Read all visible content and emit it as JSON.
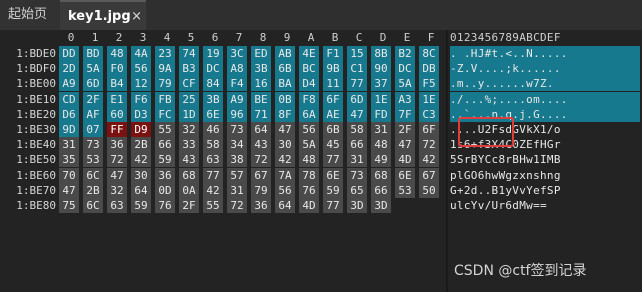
{
  "tabs": [
    {
      "label": "起始页"
    },
    {
      "label": "key1.jpg",
      "close": "×"
    }
  ],
  "columns": [
    "0",
    "1",
    "2",
    "3",
    "4",
    "5",
    "6",
    "7",
    "8",
    "9",
    "A",
    "B",
    "C",
    "D",
    "E",
    "F"
  ],
  "ascii_header": "0123456789ABCDEF",
  "rows": [
    {
      "offset": "1:BDE0",
      "bytes": [
        "DD",
        "BD",
        "48",
        "4A",
        "23",
        "74",
        "19",
        "3C",
        "ED",
        "AB",
        "4E",
        "F1",
        "15",
        "8B",
        "B2",
        "8C"
      ],
      "ascii": ". .HJ#t.<..N....."
    },
    {
      "offset": "1:BDF0",
      "bytes": [
        "2D",
        "5A",
        "F0",
        "56",
        "9A",
        "B3",
        "DC",
        "A8",
        "3B",
        "6B",
        "BC",
        "9B",
        "C1",
        "90",
        "DC",
        "DB"
      ],
      "ascii": "-Z.V....;k......"
    },
    {
      "offset": "1:BE00",
      "bytes": [
        "A9",
        "6D",
        "B4",
        "12",
        "79",
        "CF",
        "84",
        "F4",
        "16",
        "BA",
        "D4",
        "11",
        "77",
        "37",
        "5A",
        "F5"
      ],
      "ascii": ".m..y......w7Z."
    },
    {
      "offset": "1:BE10",
      "bytes": [
        "CD",
        "2F",
        "E1",
        "F6",
        "FB",
        "25",
        "3B",
        "A9",
        "BE",
        "0B",
        "F8",
        "6F",
        "6D",
        "1E",
        "A3",
        "1E"
      ],
      "ascii": "./...%;....om...."
    },
    {
      "offset": "1:BE20",
      "bytes": [
        "D6",
        "AF",
        "60",
        "D3",
        "FC",
        "1D",
        "6E",
        "96",
        "71",
        "8F",
        "6A",
        "AE",
        "47",
        "FD",
        "7F",
        "C3"
      ],
      "ascii": "..`...n.q.j.G...."
    },
    {
      "offset": "1:BE30",
      "bytes": [
        "9D",
        "07",
        "FF",
        "D9",
        "55",
        "32",
        "46",
        "73",
        "64",
        "47",
        "56",
        "6B",
        "58",
        "31",
        "2F",
        "6F"
      ],
      "ascii": "....U2FsdGVkX1/o"
    },
    {
      "offset": "1:BE40",
      "bytes": [
        "31",
        "73",
        "36",
        "2B",
        "66",
        "33",
        "58",
        "34",
        "43",
        "30",
        "5A",
        "45",
        "66",
        "48",
        "47",
        "72"
      ],
      "ascii": "1s6+f3X4C0ZEfHGr"
    },
    {
      "offset": "1:BE50",
      "bytes": [
        "35",
        "53",
        "72",
        "42",
        "59",
        "43",
        "63",
        "38",
        "72",
        "42",
        "48",
        "77",
        "31",
        "49",
        "4D",
        "42"
      ],
      "ascii": "5SrBYCc8rBHw1IMB"
    },
    {
      "offset": "1:BE60",
      "bytes": [
        "70",
        "6C",
        "47",
        "30",
        "36",
        "68",
        "77",
        "57",
        "67",
        "7A",
        "78",
        "6E",
        "73",
        "68",
        "6E",
        "67"
      ],
      "ascii": "plGO6hwWgzxnshng"
    },
    {
      "offset": "1:BE70",
      "bytes": [
        "47",
        "2B",
        "32",
        "64",
        "0D",
        "0A",
        "42",
        "31",
        "79",
        "56",
        "76",
        "59",
        "65",
        "66",
        "53",
        "50"
      ],
      "ascii": "G+2d..B1yVvYefSP"
    },
    {
      "offset": "1:BE80",
      "bytes": [
        "75",
        "6C",
        "63",
        "59",
        "76",
        "2F",
        "55",
        "72",
        "36",
        "64",
        "4D",
        "77",
        "3D",
        "3D"
      ],
      "ascii": "ulcYv/Ur6dMw=="
    }
  ],
  "selected_rows": 5,
  "selected_row5_count": 2,
  "watermark": "CSDN @ctf签到记录",
  "colors": {
    "selected": "#17798e",
    "plain": "#4a4a4a",
    "highlight": "#7a1212",
    "annotation": "#e03c3c"
  }
}
